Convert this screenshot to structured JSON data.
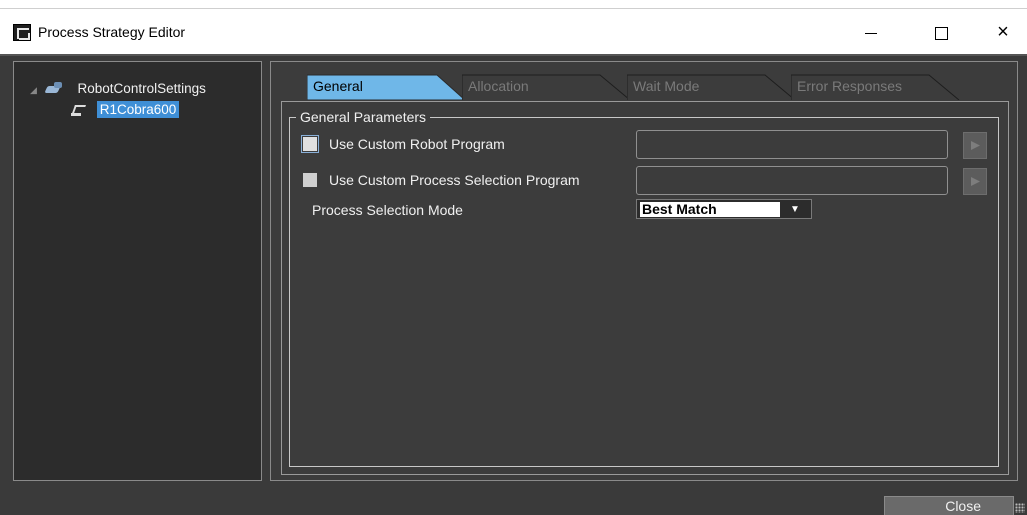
{
  "window": {
    "title": "Process Strategy Editor",
    "minimize_icon": "minimize-icon",
    "maximize_icon": "maximize-icon",
    "close_icon": "close-icon",
    "close_glyph": "×"
  },
  "tree": {
    "root": {
      "label": "RobotControlSettings",
      "icon": "gear-icon",
      "expanded": true
    },
    "child": {
      "label": "R1Cobra600",
      "icon": "robot-icon",
      "selected": true
    }
  },
  "tabs": [
    {
      "label": "General",
      "active": true
    },
    {
      "label": "Allocation",
      "active": false
    },
    {
      "label": "Wait Mode",
      "active": false
    },
    {
      "label": "Error Responses",
      "active": false
    }
  ],
  "general": {
    "group_title": "General Parameters",
    "custom_robot_program": {
      "label": "Use Custom Robot Program",
      "checked": false,
      "value": ""
    },
    "custom_process_selection": {
      "label": "Use Custom Process Selection Program",
      "checked": false,
      "value": ""
    },
    "process_selection_mode": {
      "label": "Process Selection Mode",
      "value": "Best Match",
      "arrow": "▼"
    }
  },
  "footer": {
    "close_label": "Close"
  },
  "colors": {
    "accent": "#3f8fd6",
    "background": "#3a3a3a",
    "tab_active": "#6fb7e8"
  }
}
